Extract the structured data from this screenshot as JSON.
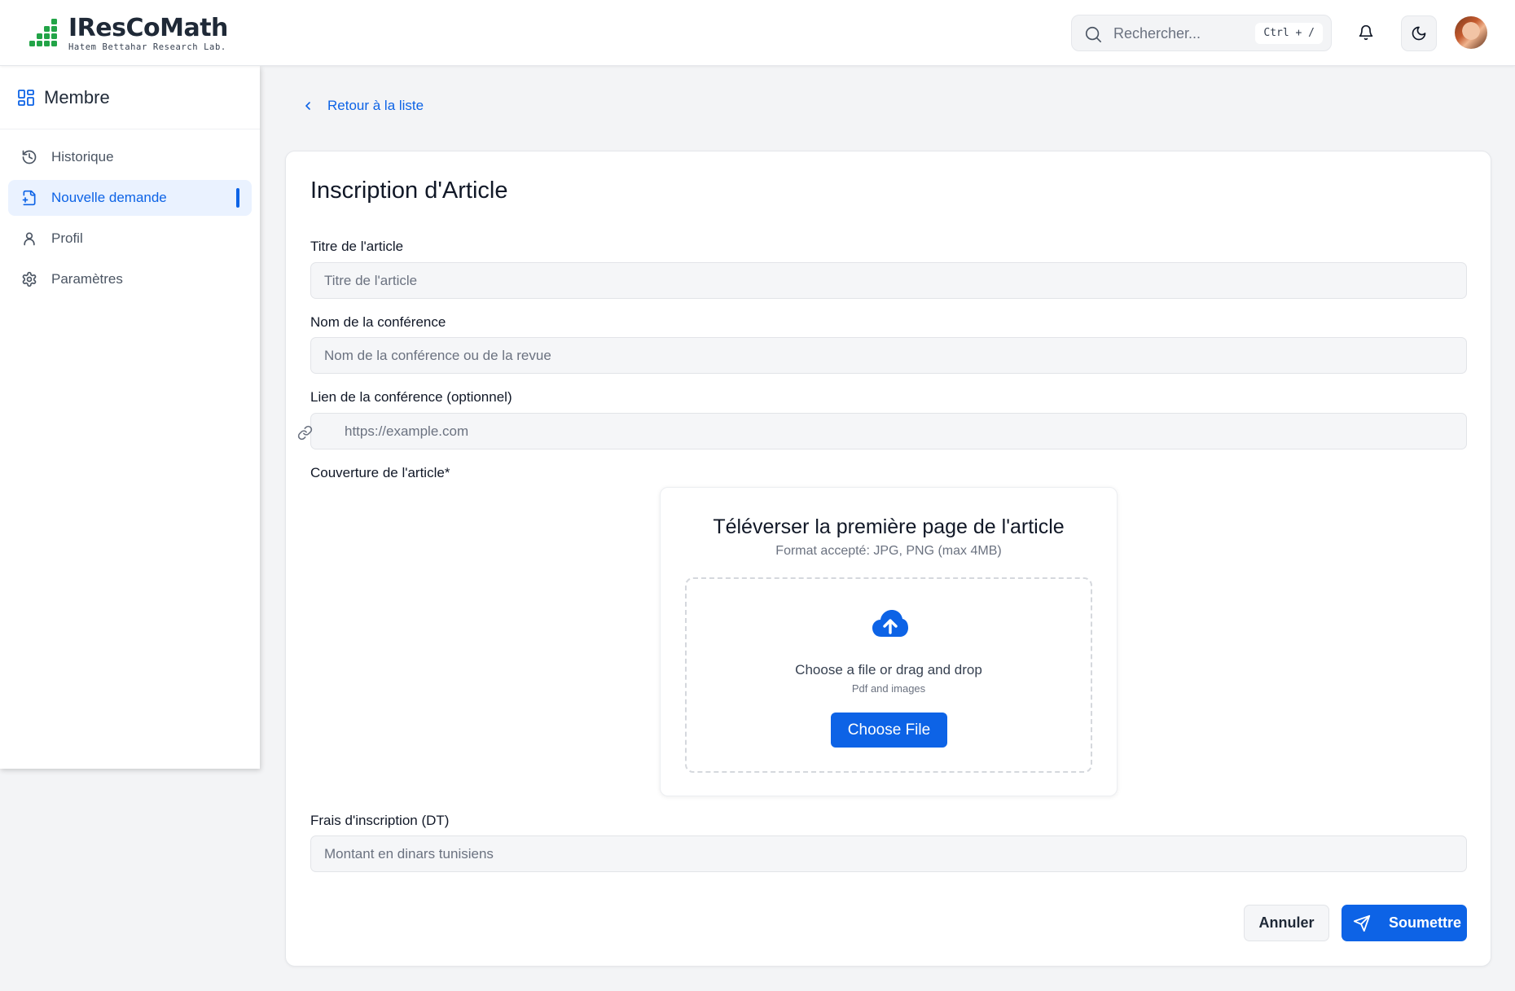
{
  "header": {
    "logo_title": "IResCoMath",
    "logo_subtitle": "Hatem Bettahar Research Lab.",
    "search_placeholder": "Rechercher...",
    "search_shortcut": "Ctrl + /",
    "icons": [
      "search-icon",
      "bell-icon",
      "moon-icon"
    ],
    "colors": {
      "accent": "#0d63e6",
      "logo_green": "#22a447"
    }
  },
  "sidebar": {
    "title": "Membre",
    "items": [
      {
        "label": "Historique",
        "icon": "history-icon",
        "active": false
      },
      {
        "label": "Nouvelle demande",
        "icon": "file-plus-icon",
        "active": true
      },
      {
        "label": "Profil",
        "icon": "user-icon",
        "active": false
      },
      {
        "label": "Paramètres",
        "icon": "gear-icon",
        "active": false
      }
    ]
  },
  "main": {
    "back_label": "Retour à la liste",
    "form": {
      "title": "Inscription d'Article",
      "article_title": {
        "label": "Titre de l'article",
        "placeholder": "Titre de l'article",
        "value": ""
      },
      "conference_name": {
        "label": "Nom de la conférence",
        "placeholder": "Nom de la conférence ou de la revue",
        "value": ""
      },
      "conference_link": {
        "label": "Lien de la conférence (optionnel)",
        "placeholder": "https://example.com",
        "value": ""
      },
      "cover": {
        "label": "Couverture de l'article*",
        "upload_title": "Téléverser la première page de l'article",
        "upload_subtitle": "Format accepté: JPG, PNG (max 4MB)",
        "drop_text": "Choose a file or drag and drop",
        "drop_hint": "Pdf and images",
        "choose_button": "Choose File"
      },
      "fees": {
        "label": "Frais d'inscription (DT)",
        "placeholder": "Montant en dinars tunisiens",
        "value": ""
      },
      "cancel_label": "Annuler",
      "submit_label": "Soumettre"
    }
  }
}
